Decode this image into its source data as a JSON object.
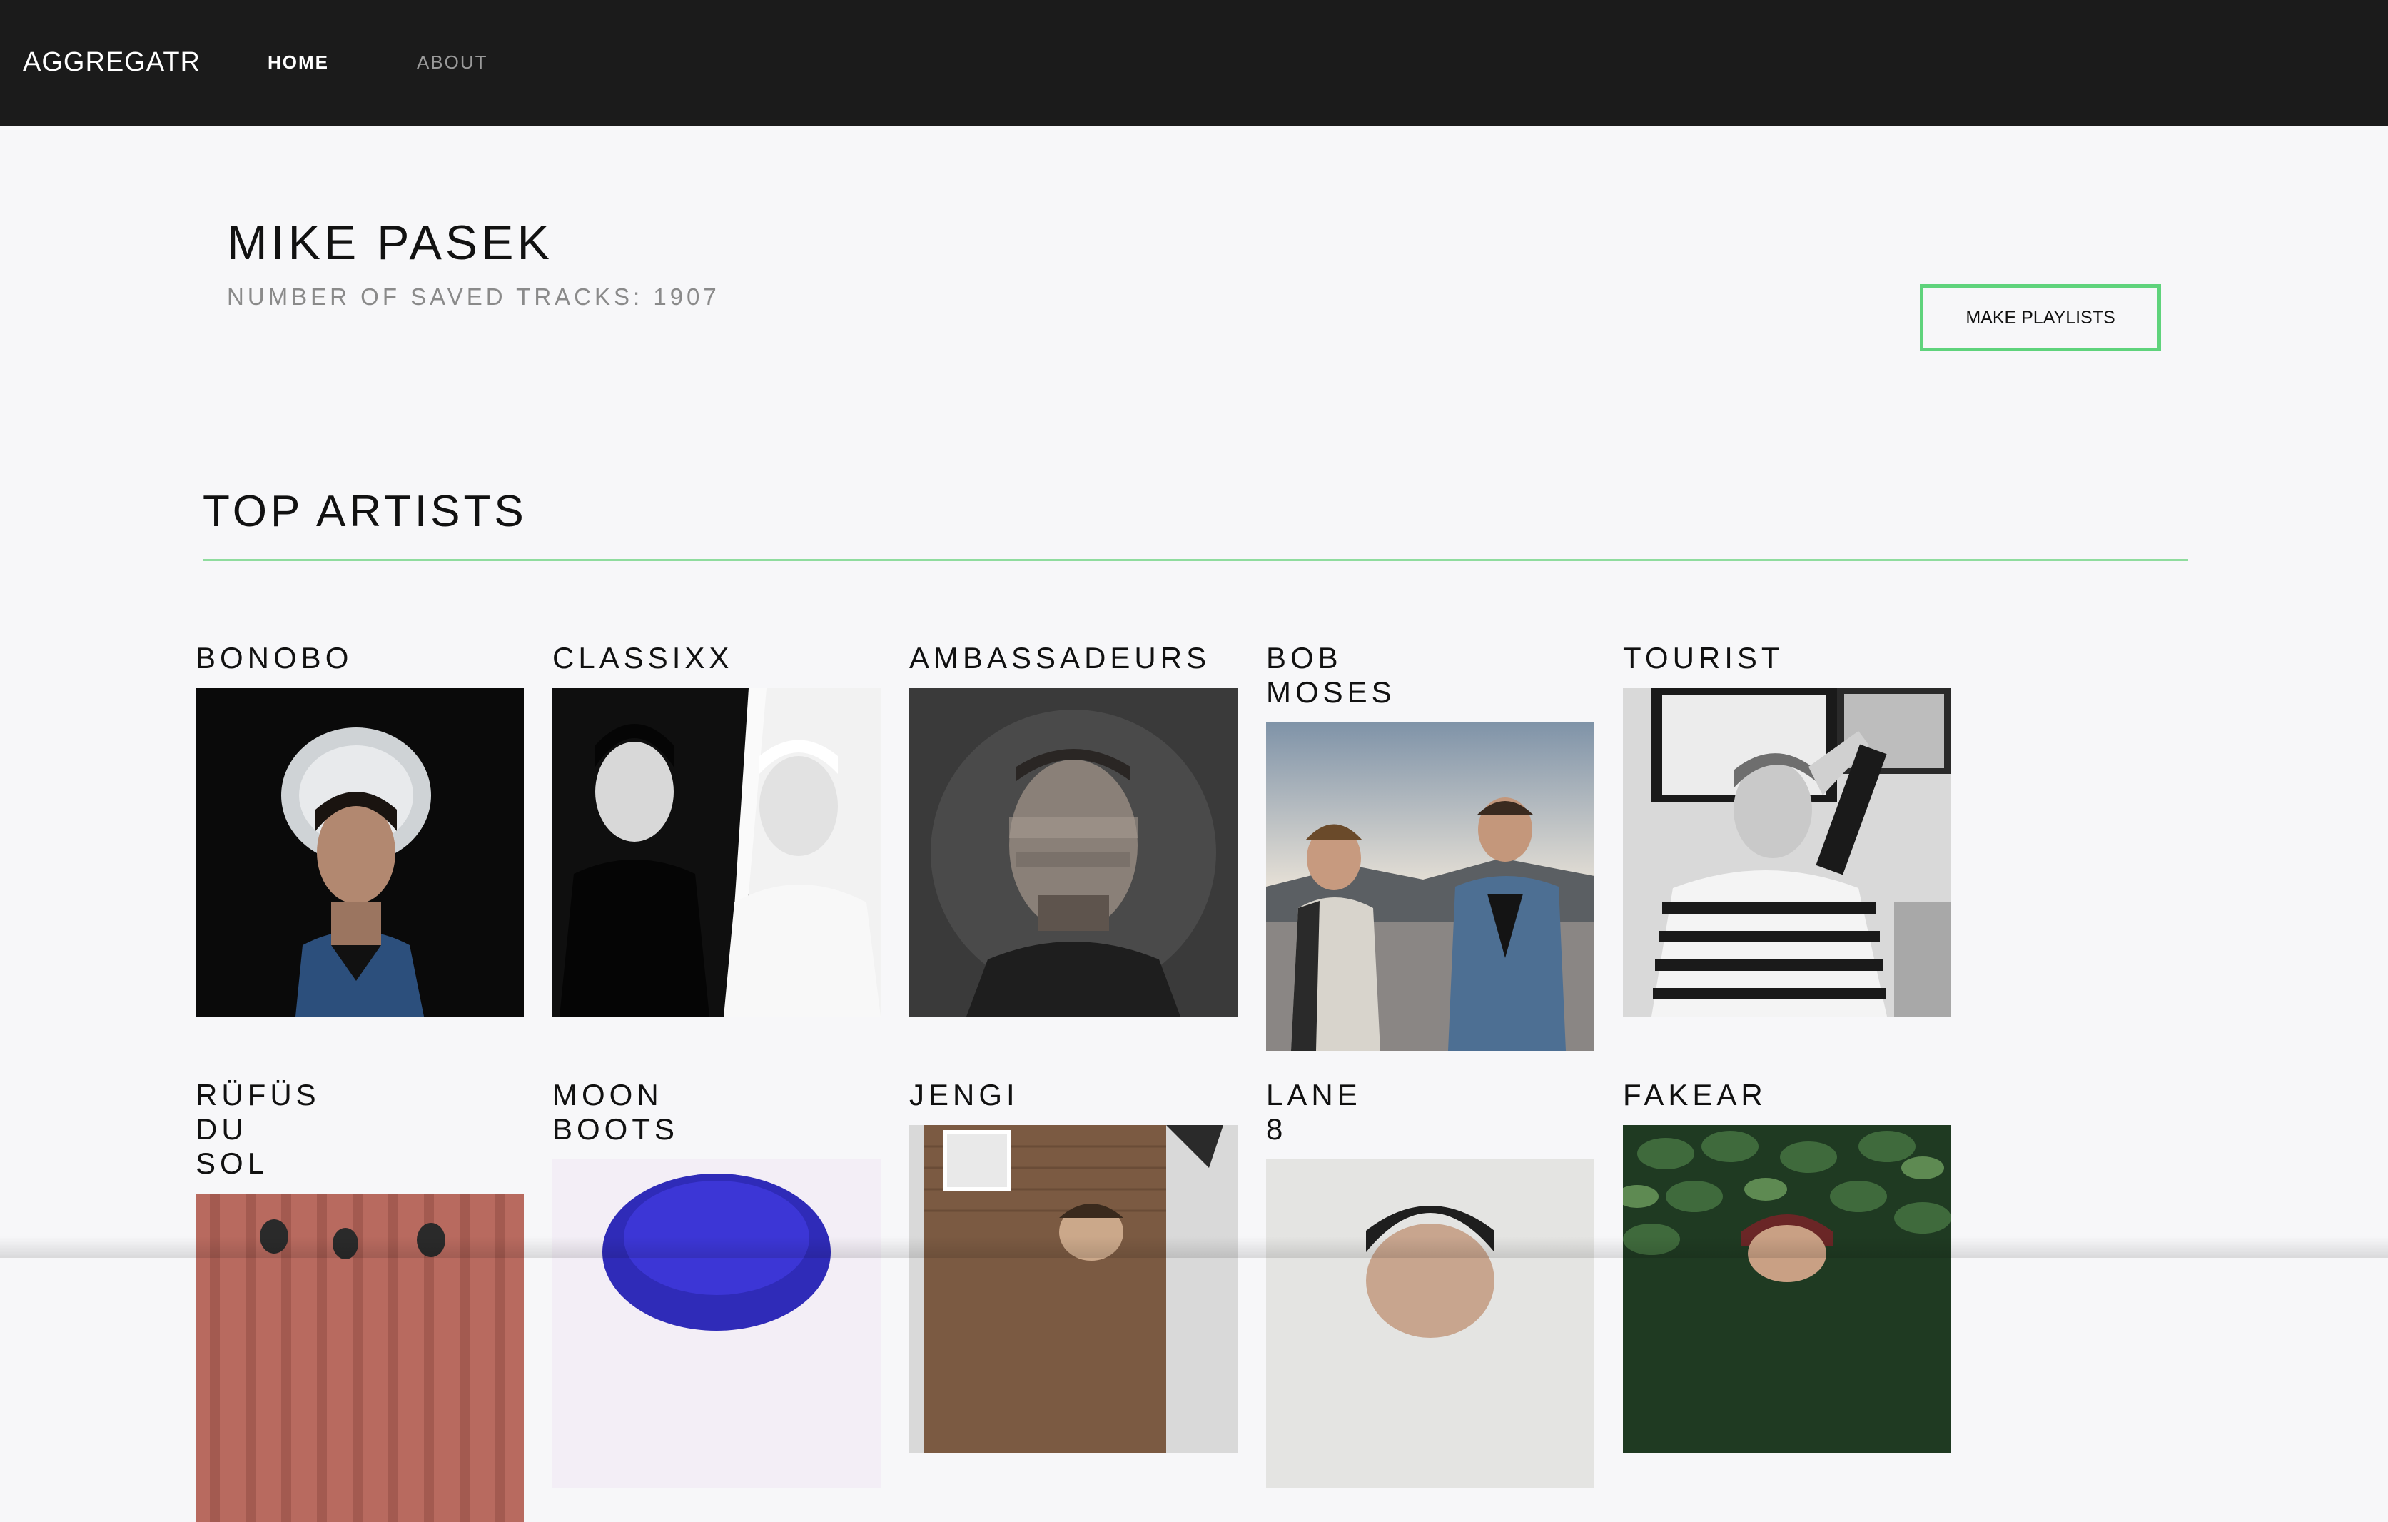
{
  "nav": {
    "brand": "AGGREGATR",
    "home": "HOME",
    "about": "ABOUT"
  },
  "profile": {
    "name": "MIKE PASEK",
    "saved_tracks": "NUMBER OF SAVED TRACKS: 1907",
    "make_playlists_label": "MAKE PLAYLISTS"
  },
  "top_artists": {
    "title": "TOP ARTISTS",
    "items": [
      {
        "name": "BONOBO"
      },
      {
        "name": "CLASSIXX"
      },
      {
        "name": "AMBASSADEURS"
      },
      {
        "name": "BOB MOSES"
      },
      {
        "name": "TOURIST"
      },
      {
        "name": "RÜFÜS DU SOL"
      },
      {
        "name": "MOON BOOTS"
      },
      {
        "name": "JENGI"
      },
      {
        "name": "LANE 8"
      },
      {
        "name": "FAKEAR"
      }
    ]
  },
  "colors": {
    "nav_bg": "#1b1b1b",
    "page_bg": "#f7f7f9",
    "accent": "#5fd37c"
  }
}
